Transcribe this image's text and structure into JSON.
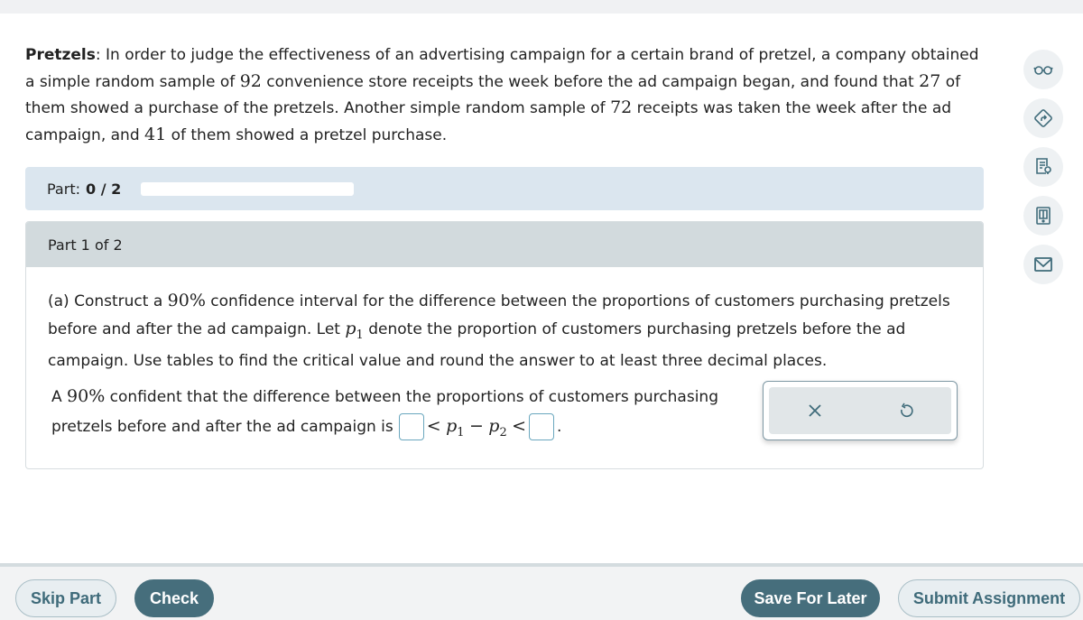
{
  "problem": {
    "title": "Pretzels",
    "text_1": ": In order to judge the effectiveness of an advertising campaign for a certain brand of pretzel, a company obtained a simple random sample of ",
    "n1": "92",
    "text_2": " convenience store receipts the week before the ad campaign began, and found that ",
    "x1": "27",
    "text_3": " of them showed a purchase of the pretzels. Another simple random sample of ",
    "n2": "72",
    "text_4": " receipts was taken the week after the ad campaign, and ",
    "x2": "41",
    "text_5": " of them showed a pretzel purchase."
  },
  "side_tools": [
    {
      "icon": "glasses-icon",
      "label": "Read aloud"
    },
    {
      "icon": "directions-icon",
      "label": "Directions"
    },
    {
      "icon": "hint-document-icon",
      "label": "Hint"
    },
    {
      "icon": "ebook-icon",
      "label": "eBook"
    },
    {
      "icon": "mail-icon",
      "label": "Message"
    }
  ],
  "progress": {
    "label": "Part:",
    "value": "0 / 2",
    "fraction": 0
  },
  "part": {
    "header": "Part 1 of 2",
    "q_prefix": "(a) Construct a ",
    "q_pct": "90%",
    "q_mid": " confidence interval for the difference between the proportions of customers purchasing pretzels before and after the ad campaign. Let ",
    "q_var": "p",
    "q_var_sub": "1",
    "q_suffix": " denote the proportion of customers purchasing pretzels before the ad campaign. Use tables to find the critical value and round the answer to at least three decimal places.",
    "a_prefix": "A ",
    "a_pct": "90%",
    "a_mid": " confident that the difference between the proportions of customers purchasing pretzels before and after the ad campaign is",
    "lt1": "<",
    "p1": "p",
    "p1_sub": "1",
    "minus": "−",
    "p2": "p",
    "p2_sub": "2",
    "lt2": "<",
    "end": ".",
    "lower_value": "",
    "upper_value": ""
  },
  "tool_panel": {
    "clear_icon": "x-icon",
    "undo_icon": "undo-icon"
  },
  "footer": {
    "skip": "Skip Part",
    "check": "Check",
    "save": "Save For Later",
    "submit": "Submit Assignment"
  }
}
